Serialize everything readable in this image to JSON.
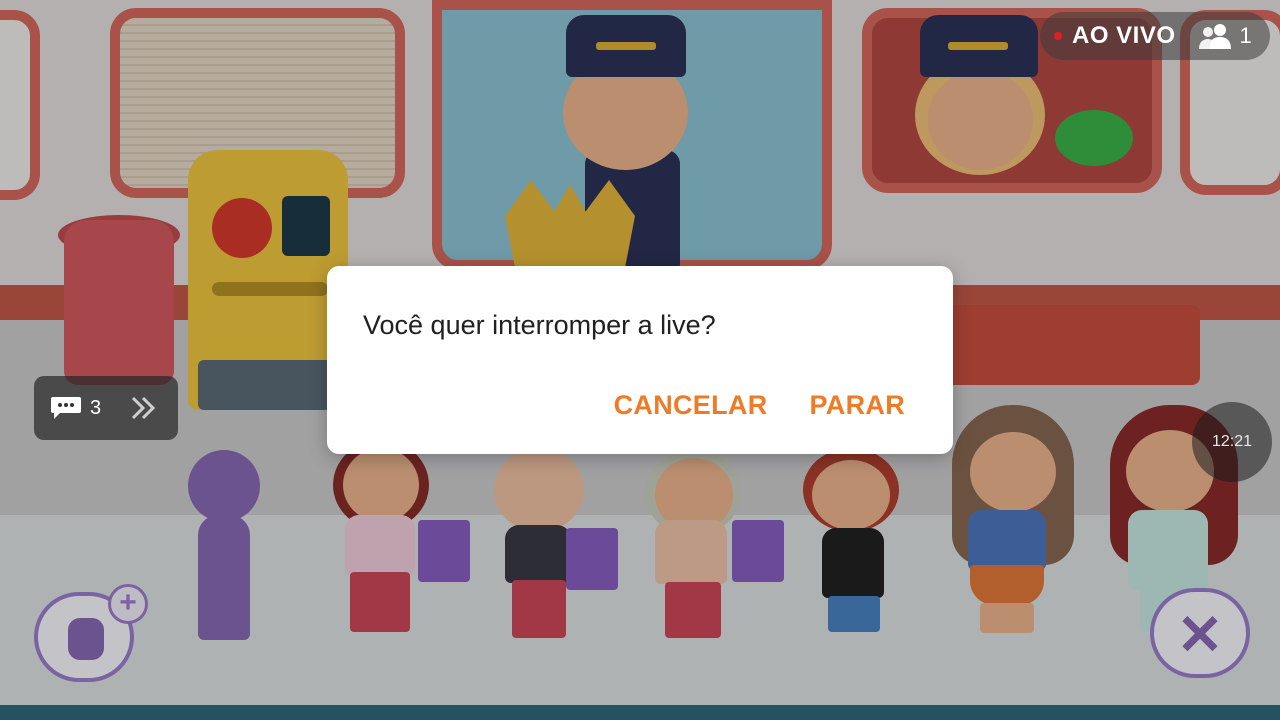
{
  "stream": {
    "live_label": "AO VIVO",
    "viewer_count": "1",
    "chat_count": "3",
    "clock": "12:21"
  },
  "dialog": {
    "message": "Você quer interromper a live?",
    "cancel_label": "CANCELAR",
    "stop_label": "PARAR"
  },
  "colors": {
    "dialog_button": "#ef7b26",
    "live_dot": "#e02020"
  },
  "icons": {
    "viewers": "people-icon",
    "chat": "chat-bubble-icon",
    "chevrons": "double-chevron-right-icon",
    "add_character": "add-character-icon",
    "close": "close-icon",
    "play": "play-icon"
  }
}
